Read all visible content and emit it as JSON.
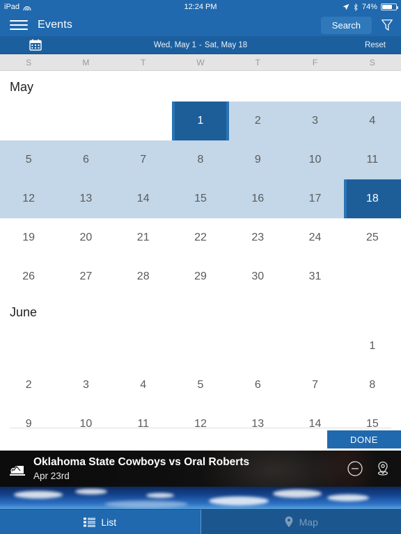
{
  "status_bar": {
    "device": "iPad",
    "wifi_icon": "wifi-icon",
    "time": "12:24 PM",
    "location_icon": "location-arrow-icon",
    "bluetooth_icon": "bluetooth-icon",
    "battery_percent": "74%",
    "battery_level": 74
  },
  "nav_bar": {
    "menu_icon": "hamburger-menu-icon",
    "title": "Events",
    "search_label": "Search",
    "filter_icon": "filter-funnel-icon"
  },
  "range_bar": {
    "calendar_icon": "calendar-icon",
    "start_date": "Wed, May 1",
    "separator": "-",
    "end_date": "Sat, May 18",
    "reset_label": "Reset"
  },
  "calendar": {
    "weekday_headers": [
      "S",
      "M",
      "T",
      "W",
      "T",
      "F",
      "S"
    ],
    "months": [
      {
        "name": "May",
        "weeks": [
          {
            "highlighted": false,
            "days": [
              "",
              "",
              "",
              "1",
              "2",
              "3",
              "4"
            ],
            "selected": [
              3
            ],
            "range": [
              3,
              4,
              5,
              6
            ]
          },
          {
            "highlighted": true,
            "days": [
              "5",
              "6",
              "7",
              "8",
              "9",
              "10",
              "11"
            ],
            "selected": [],
            "range": [
              0,
              1,
              2,
              3,
              4,
              5,
              6
            ]
          },
          {
            "highlighted": true,
            "days": [
              "12",
              "13",
              "14",
              "15",
              "16",
              "17",
              "18"
            ],
            "selected": [
              6
            ],
            "range": [
              0,
              1,
              2,
              3,
              4,
              5,
              6
            ]
          },
          {
            "highlighted": false,
            "days": [
              "19",
              "20",
              "21",
              "22",
              "23",
              "24",
              "25"
            ],
            "selected": [],
            "range": []
          },
          {
            "highlighted": false,
            "days": [
              "26",
              "27",
              "28",
              "29",
              "30",
              "31",
              ""
            ],
            "selected": [],
            "range": []
          }
        ]
      },
      {
        "name": "June",
        "weeks": [
          {
            "highlighted": false,
            "days": [
              "",
              "",
              "",
              "",
              "",
              "",
              "1"
            ],
            "selected": [],
            "range": []
          },
          {
            "highlighted": false,
            "days": [
              "2",
              "3",
              "4",
              "5",
              "6",
              "7",
              "8"
            ],
            "selected": [],
            "range": []
          },
          {
            "highlighted": false,
            "days": [
              "9",
              "10",
              "11",
              "12",
              "13",
              "14",
              "15"
            ],
            "selected": [],
            "range": []
          }
        ]
      }
    ]
  },
  "done_button": {
    "label": "DONE"
  },
  "event_card": {
    "icon": "sports-event-icon",
    "title": "Oklahoma State Cowboys vs Oral Roberts",
    "date": "Apr 23rd",
    "remove_icon": "minus-circle-icon",
    "map_icon": "map-pin-icon"
  },
  "tab_bar": {
    "tabs": [
      {
        "label": "List",
        "icon": "list-icon",
        "active": true
      },
      {
        "label": "Map",
        "icon": "map-pin-icon",
        "active": false
      }
    ]
  },
  "colors": {
    "nav_blue": "#2069ae",
    "range_blue": "#1c5f9e",
    "selected_day": "#1d5e99",
    "range_highlight": "#c3d7e8",
    "weekday_bg": "#e4e4e4",
    "tab_inactive": "#1c568f",
    "card_bg": "#1b1b1b"
  }
}
